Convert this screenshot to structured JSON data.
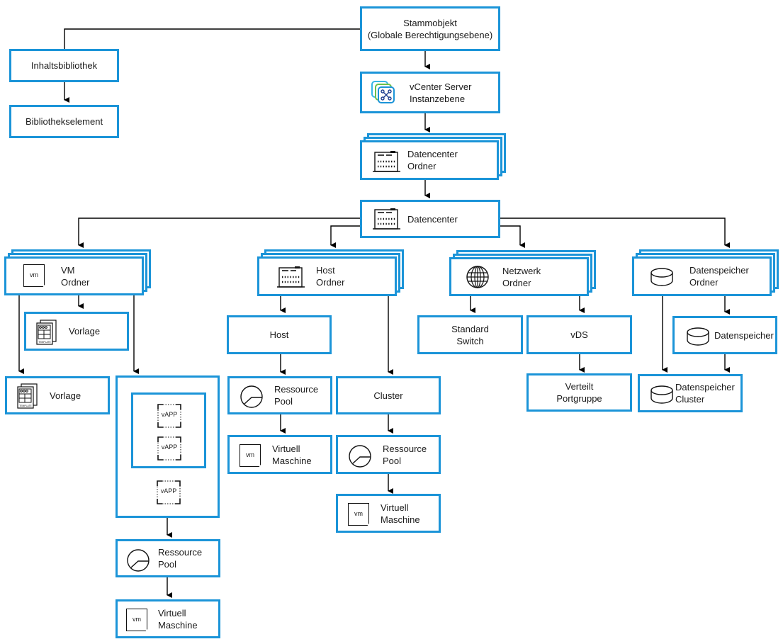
{
  "colors": {
    "box_border": "#1b94d8",
    "line": "#000000"
  },
  "nodes": {
    "root": {
      "label": "Stammobjekt\n(Globale Berechtigungsebene)"
    },
    "content_library": {
      "label": "Inhaltsbibliothek"
    },
    "library_item": {
      "label": "Bibliothekselement"
    },
    "vcenter": {
      "label": "vCenter Server\nInstanzebene",
      "icon": "vcenter-icon"
    },
    "datacenter_folder": {
      "label": "Datencenter\nOrdner",
      "icon": "datacenter-icon"
    },
    "datacenter": {
      "label": "Datencenter",
      "icon": "datacenter-icon"
    },
    "vm_folder": {
      "label": "VM\nOrdner",
      "icon": "vm-icon"
    },
    "template_1": {
      "label": "Vorlage",
      "icon": "template-icon"
    },
    "template_2": {
      "label": "Vorlage",
      "icon": "template-icon"
    },
    "vapp_group": {
      "items": [
        "vAPP",
        "vAPP",
        "vAPP"
      ]
    },
    "resource_pool_vm": {
      "label": "Ressource\nPool",
      "icon": "resource-pool-icon"
    },
    "vm_vm": {
      "label": "Virtuell\nMaschine",
      "icon": "vm-icon"
    },
    "host_folder": {
      "label": "Host\nOrdner",
      "icon": "datacenter-icon"
    },
    "host": {
      "label": "Host"
    },
    "resource_pool_host": {
      "label": "Ressource\nPool",
      "icon": "resource-pool-icon"
    },
    "vm_host": {
      "label": "Virtuell\nMaschine",
      "icon": "vm-icon"
    },
    "cluster": {
      "label": "Cluster"
    },
    "resource_pool_cluster": {
      "label": "Ressource\nPool",
      "icon": "resource-pool-icon"
    },
    "vm_cluster": {
      "label": "Virtuell\nMaschine",
      "icon": "vm-icon"
    },
    "network_folder": {
      "label": "Netzwerk\nOrdner",
      "icon": "globe-icon"
    },
    "standard_switch": {
      "label": "Standard\nSwitch"
    },
    "vds": {
      "label": "vDS"
    },
    "dist_portgroup": {
      "label": "Verteilt\nPortgruppe"
    },
    "datastore_folder": {
      "label": "Datenspeicher\nOrdner",
      "icon": "datastore-icon"
    },
    "datastore": {
      "label": "Datenspeicher",
      "icon": "datastore-icon"
    },
    "datastore_cluster": {
      "label": "Datenspeicher\nCluster",
      "icon": "datastore-icon"
    }
  },
  "icon_text": {
    "vm": "vm",
    "template": "TEMPLATE"
  }
}
